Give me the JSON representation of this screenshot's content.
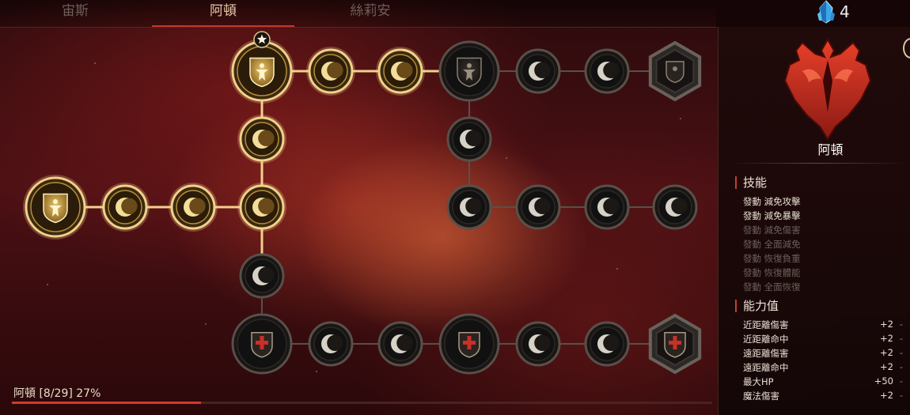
{
  "tabs": [
    {
      "label": "宙斯",
      "active": false
    },
    {
      "label": "阿頓",
      "active": true
    },
    {
      "label": "絲莉安",
      "active": false
    }
  ],
  "currency": {
    "icon": "blue-crystal-icon",
    "count": "4"
  },
  "panel": {
    "emblem_icon": "red-winged-emblem-icon",
    "character_name": "阿頓",
    "skills_title": "技能",
    "skills": [
      {
        "label": "發動 減免攻擊",
        "unlocked": true
      },
      {
        "label": "發動 減免暴擊",
        "unlocked": true
      },
      {
        "label": "發動 減免傷害",
        "unlocked": false
      },
      {
        "label": "發動 全面減免",
        "unlocked": false
      },
      {
        "label": "發動 恢復負重",
        "unlocked": false
      },
      {
        "label": "發動 恢復體能",
        "unlocked": false
      },
      {
        "label": "發動 全面恢復",
        "unlocked": false
      }
    ],
    "stats_title": "能力值",
    "stats": [
      {
        "label": "近距離傷害",
        "value": "+2",
        "suffix": "-"
      },
      {
        "label": "近距離命中",
        "value": "+2",
        "suffix": "-"
      },
      {
        "label": "遠距離傷害",
        "value": "+2",
        "suffix": "-"
      },
      {
        "label": "遠距離命中",
        "value": "+2",
        "suffix": "-"
      },
      {
        "label": "最大HP",
        "value": "+50",
        "suffix": "-"
      },
      {
        "label": "魔法傷害",
        "value": "+2",
        "suffix": "-"
      }
    ]
  },
  "tree": {
    "nodes": [
      {
        "id": "root",
        "kind": "shield-figure",
        "state": "active",
        "icon": "shield-figure-icon"
      },
      {
        "id": "l1",
        "kind": "moon",
        "state": "active",
        "icon": "crescent-moon-icon"
      },
      {
        "id": "l2",
        "kind": "moon",
        "state": "active",
        "icon": "crescent-moon-icon"
      },
      {
        "id": "hub",
        "kind": "moon",
        "state": "active",
        "icon": "crescent-moon-icon"
      },
      {
        "id": "up1",
        "kind": "moon",
        "state": "active",
        "icon": "crescent-moon-icon"
      },
      {
        "id": "star",
        "kind": "shield-figure",
        "state": "active",
        "icon": "shield-figure-icon",
        "badge": "star-icon"
      },
      {
        "id": "t1",
        "kind": "moon",
        "state": "active",
        "icon": "crescent-moon-icon"
      },
      {
        "id": "t2",
        "kind": "moon",
        "state": "active",
        "icon": "crescent-moon-icon"
      },
      {
        "id": "tb",
        "kind": "shield-figure",
        "state": "inactive",
        "icon": "shield-figure-icon"
      },
      {
        "id": "t4",
        "kind": "moon",
        "state": "inactive",
        "icon": "crescent-moon-icon"
      },
      {
        "id": "t5",
        "kind": "moon",
        "state": "inactive",
        "icon": "crescent-moon-icon"
      },
      {
        "id": "t6",
        "kind": "hexagon",
        "state": "inactive",
        "icon": "hexagon-crest-icon"
      },
      {
        "id": "m1",
        "kind": "moon",
        "state": "inactive",
        "icon": "crescent-moon-icon"
      },
      {
        "id": "m2",
        "kind": "moon",
        "state": "inactive",
        "icon": "crescent-moon-icon"
      },
      {
        "id": "m3",
        "kind": "moon",
        "state": "inactive",
        "icon": "crescent-moon-icon"
      },
      {
        "id": "m4",
        "kind": "moon",
        "state": "inactive",
        "icon": "crescent-moon-icon"
      },
      {
        "id": "m5",
        "kind": "moon",
        "state": "inactive",
        "icon": "crescent-moon-icon"
      },
      {
        "id": "d1",
        "kind": "moon",
        "state": "inactive",
        "icon": "crescent-moon-icon"
      },
      {
        "id": "b1",
        "kind": "shield-cross",
        "state": "inactive",
        "icon": "shield-cross-icon"
      },
      {
        "id": "b2",
        "kind": "moon",
        "state": "inactive",
        "icon": "crescent-moon-icon"
      },
      {
        "id": "b3",
        "kind": "moon",
        "state": "inactive",
        "icon": "crescent-moon-icon"
      },
      {
        "id": "b4",
        "kind": "shield-cross",
        "state": "inactive",
        "icon": "shield-cross-icon"
      },
      {
        "id": "b5",
        "kind": "moon",
        "state": "inactive",
        "icon": "crescent-moon-icon"
      },
      {
        "id": "b6",
        "kind": "moon",
        "state": "inactive",
        "icon": "crescent-moon-icon"
      },
      {
        "id": "b7",
        "kind": "hexagon-cross",
        "state": "inactive",
        "icon": "hexagon-cross-icon"
      }
    ]
  },
  "progress": {
    "label": "阿頓 [8/29] 27%",
    "fraction": 0.27
  }
}
